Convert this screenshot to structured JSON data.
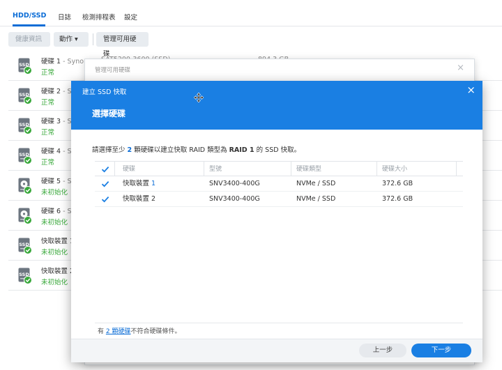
{
  "tabs": [
    {
      "label": "HDD/SSD",
      "active": true
    },
    {
      "label": "日誌"
    },
    {
      "label": "檢測排程表"
    },
    {
      "label": "設定"
    }
  ],
  "toolbar": {
    "health_info": "健康資訊",
    "actions": "動作",
    "actions_caret": "▾",
    "manage": "管理可用硬碟"
  },
  "disks": [
    {
      "name": "硬碟 1",
      "sub": " - Syno",
      "status": "正常",
      "icon": "ssd-icon",
      "extra": "SAT5200-3600 (SSD)",
      "size": "894.3 GB"
    },
    {
      "name": "硬碟 2",
      "sub": " - S",
      "status": "正常",
      "icon": "ssd-icon"
    },
    {
      "name": "硬碟 3",
      "sub": " - S",
      "status": "正常",
      "icon": "ssd-icon"
    },
    {
      "name": "硬碟 4",
      "sub": " - S",
      "status": "正常",
      "icon": "ssd-icon"
    },
    {
      "name": "硬碟 5",
      "sub": " - S",
      "status": "未初始化",
      "icon": "hdd-icon"
    },
    {
      "name": "硬碟 6",
      "sub": " - S",
      "status": "未初始化",
      "icon": "hdd-icon"
    },
    {
      "name": "快取裝置 1",
      "sub": "",
      "status": "未初始化",
      "icon": "ssd-icon"
    },
    {
      "name": "快取裝置 2",
      "sub": "",
      "status": "未初始化",
      "icon": "ssd-icon"
    }
  ],
  "back_dialog": {
    "title": "管理可用硬碟",
    "close": "×"
  },
  "dialog": {
    "title": "建立 SSD 快取",
    "close": "×",
    "step": "選擇硬碟",
    "instruction": {
      "pre": "請選擇至少",
      "count": "2",
      "mid": "顆硬碟以建立快取 RAID 類型為",
      "raid": "RAID 1",
      "post": "的 SSD 快取。"
    },
    "columns": [
      "硬碟",
      "型號",
      "硬碟類型",
      "硬碟大小"
    ],
    "rows": [
      {
        "disk_prefix": "快取裝置 ",
        "disk_num": "1",
        "model": "SNV3400-400G",
        "type": "NVMe / SSD",
        "size": "372.6 GB",
        "checked": true
      },
      {
        "disk_prefix": "快取裝置 ",
        "disk_num": "2",
        "model": "SNV3400-400G",
        "type": "NVMe / SSD",
        "size": "372.6 GB",
        "checked": true
      }
    ],
    "footnote": {
      "pre": "有 ",
      "link": "2 顆硬碟",
      "post": "不符合硬碟條件。"
    },
    "prev": "上一步",
    "next": "下一步"
  },
  "colors": {
    "accent": "#1a7fe3",
    "ok": "#38a83a"
  }
}
